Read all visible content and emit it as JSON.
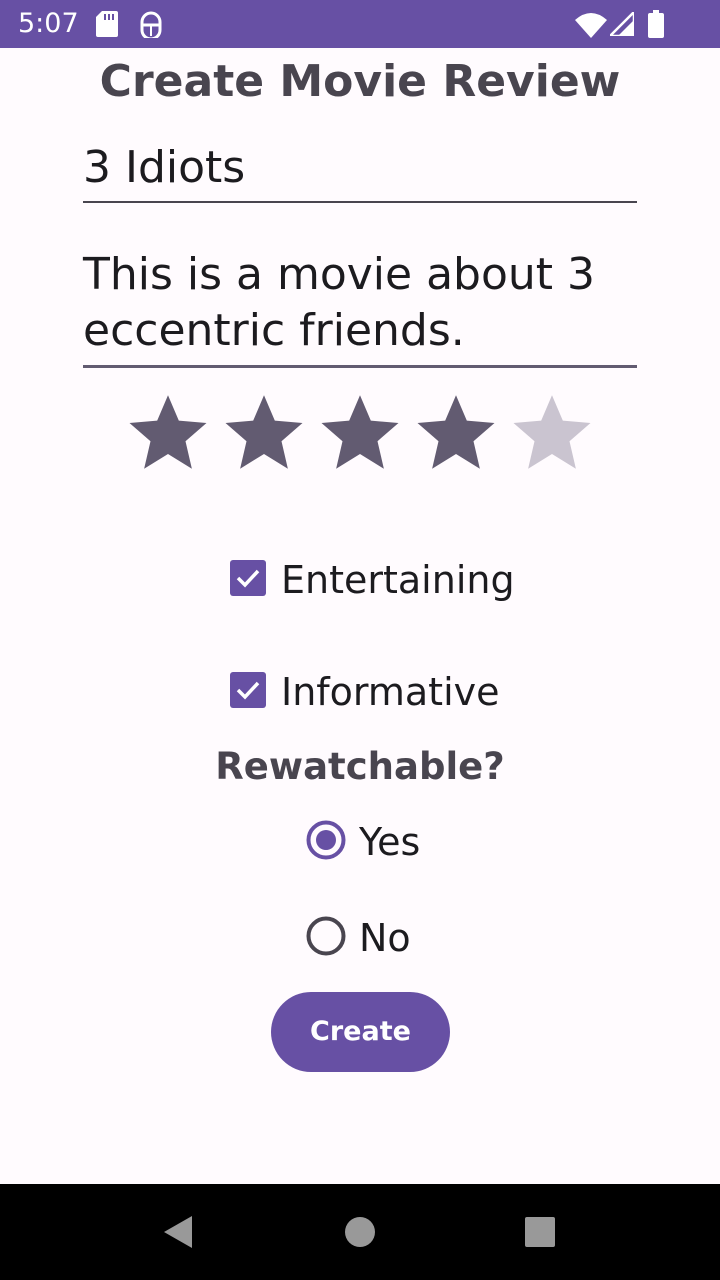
{
  "status_bar": {
    "time": "5:07",
    "background_color": "#6750A4",
    "left_icons": [
      "sd-card-icon",
      "android-debug-icon"
    ],
    "right_icons": [
      "wifi-icon",
      "signal-icon",
      "battery-icon"
    ]
  },
  "screen": {
    "title": "Create Movie Review"
  },
  "form": {
    "movie_title": "3 Idiots",
    "description": "This is a movie about 3 eccentric friends.",
    "rating": {
      "value": 4,
      "max": 5
    },
    "checkboxes": [
      {
        "label": "Entertaining",
        "checked": true
      },
      {
        "label": "Informative",
        "checked": true
      }
    ],
    "rewatchable": {
      "heading": "Rewatchable?",
      "options": [
        {
          "label": "Yes",
          "selected": true
        },
        {
          "label": "No",
          "selected": false
        }
      ]
    },
    "submit_label": "Create"
  },
  "theme": {
    "accent": "#6750A4",
    "star_filled": "#625B71",
    "star_empty": "#CAC4D0",
    "background": "#FFFBFE"
  },
  "nav_bar": {
    "buttons": [
      "back-icon",
      "home-icon",
      "recents-icon"
    ]
  }
}
